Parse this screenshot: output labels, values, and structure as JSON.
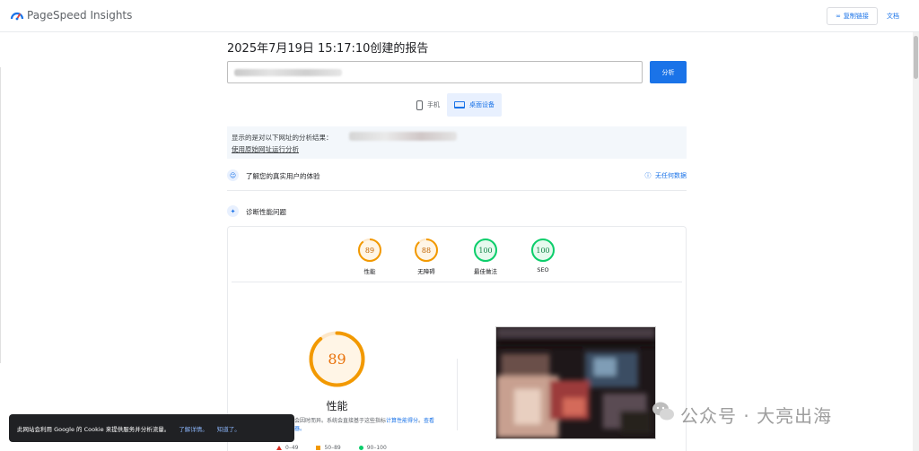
{
  "header": {
    "brand": "PageSpeed Insights",
    "copy_link_label": "复制链接",
    "docs_label": "文档"
  },
  "report": {
    "title": "2025年7月19日 15:17:10创建的报告",
    "analyze_label": "分析",
    "device_tabs": [
      {
        "label": "手机",
        "active": false
      },
      {
        "label": "桌面设备",
        "active": true
      }
    ],
    "result_label": "显示的是对以下网址的分析结果：",
    "original_link": "使用原始网址运行分析"
  },
  "sections": {
    "real_users": {
      "title": "了解您的真实用户的体验",
      "right": "无任何数据"
    },
    "diagnose": {
      "title": "诊断性能问题"
    }
  },
  "scores": [
    {
      "value": "89",
      "label": "性能",
      "color": "#f29900"
    },
    {
      "value": "88",
      "label": "无障碍",
      "color": "#f29900"
    },
    {
      "value": "100",
      "label": "最佳做法",
      "color": "#0cce6b"
    },
    {
      "value": "100",
      "label": "SEO",
      "color": "#0cce6b"
    }
  ],
  "performance": {
    "score": "89",
    "label": "性能",
    "desc_part1": "可能会因时而异。系统会直接基于这些指标",
    "desc_link1": "计算性能得分",
    "desc_part2": "。",
    "desc_link2": "查看计算器。"
  },
  "legend": [
    "0–49",
    "50–89",
    "90–100"
  ],
  "cookie": {
    "text": "此网站会利用 Google 的 Cookie 来提供服务并分析流量。",
    "learn_more": "了解详情。",
    "ok": "知道了。"
  },
  "watermark": "公众号 · 大亮出海"
}
